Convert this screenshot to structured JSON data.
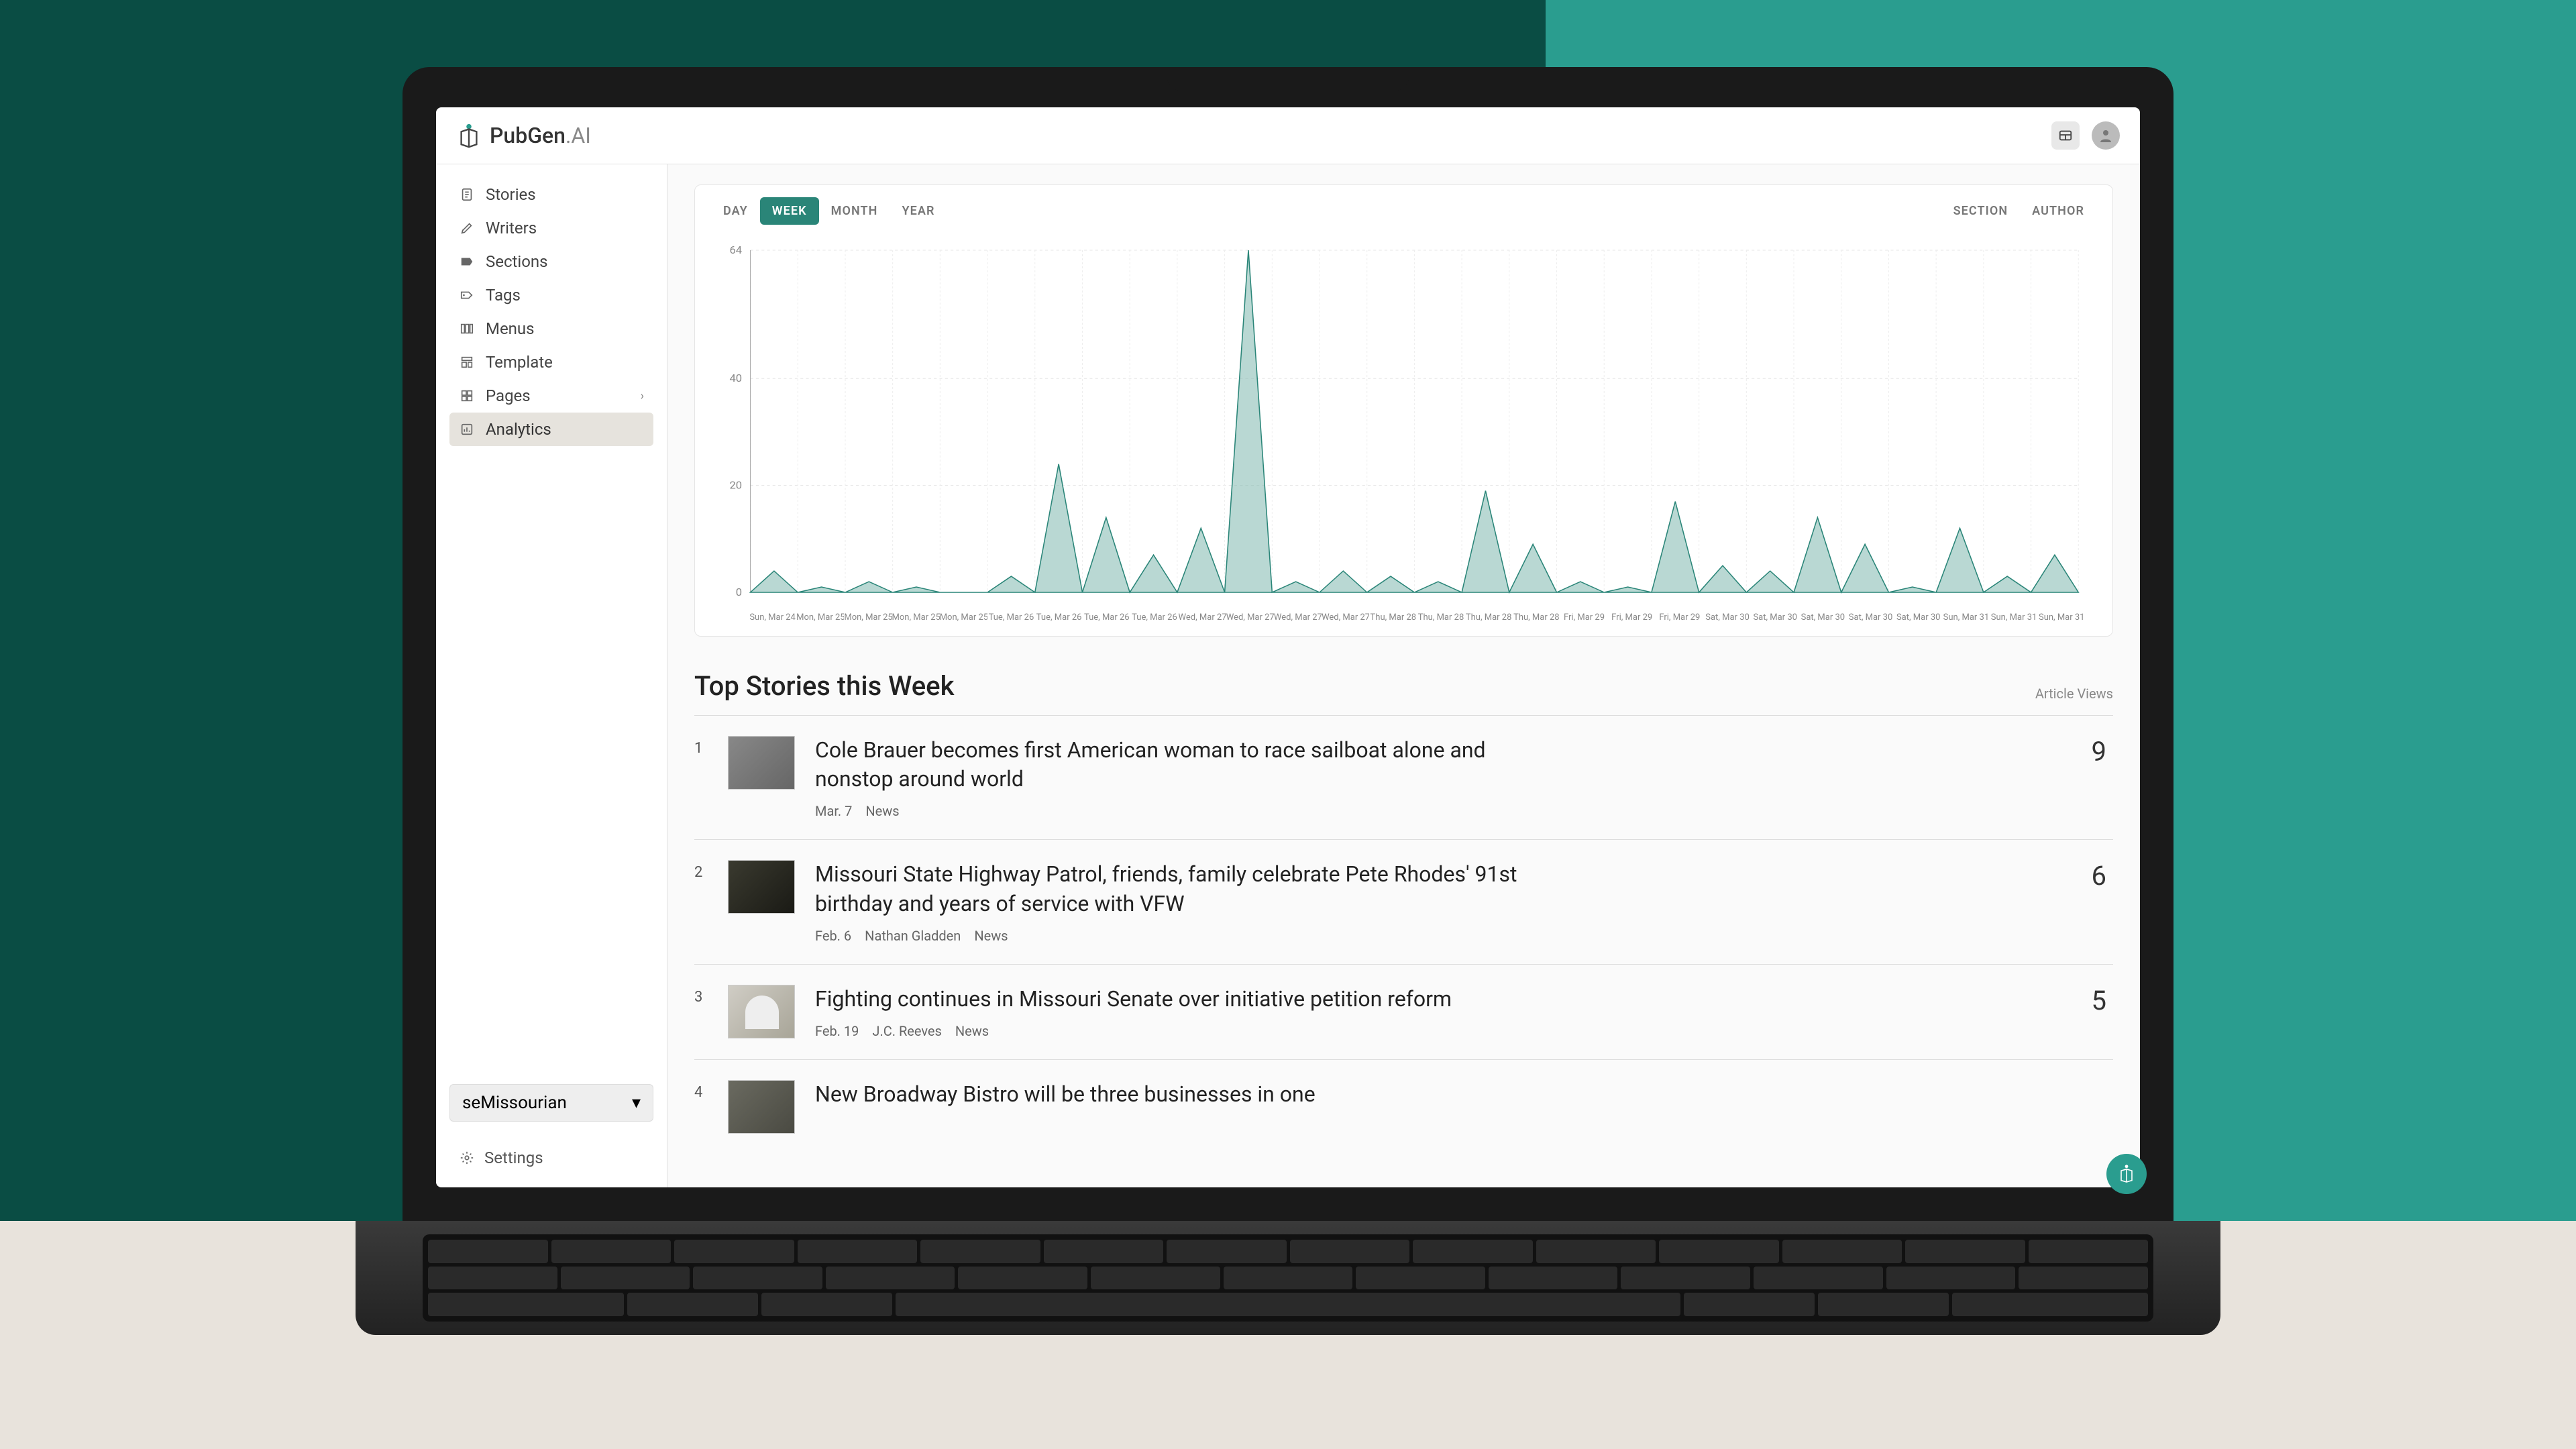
{
  "brand": {
    "name": "PubGen",
    "suffix": ".AI"
  },
  "sidebar": {
    "items": [
      {
        "label": "Stories"
      },
      {
        "label": "Writers"
      },
      {
        "label": "Sections"
      },
      {
        "label": "Tags"
      },
      {
        "label": "Menus"
      },
      {
        "label": "Template"
      },
      {
        "label": "Pages"
      },
      {
        "label": "Analytics"
      }
    ],
    "site": "seMissourian",
    "settings_label": "Settings"
  },
  "chart": {
    "periods": [
      "DAY",
      "WEEK",
      "MONTH",
      "YEAR"
    ],
    "active_period": "WEEK",
    "groups": [
      "SECTION",
      "AUTHOR"
    ]
  },
  "chart_data": {
    "type": "area",
    "title": "",
    "xlabel": "",
    "ylabel": "",
    "ylim": [
      0,
      64
    ],
    "yticks": [
      0,
      20,
      40,
      64
    ],
    "categories": [
      "Sun, Mar 24",
      "Mon, Mar 25",
      "Mon, Mar 25",
      "Mon, Mar 25",
      "Mon, Mar 25",
      "Tue, Mar 26",
      "Tue, Mar 26",
      "Tue, Mar 26",
      "Tue, Mar 26",
      "Wed, Mar 27",
      "Wed, Mar 27",
      "Wed, Mar 27",
      "Wed, Mar 27",
      "Thu, Mar 28",
      "Thu, Mar 28",
      "Thu, Mar 28",
      "Thu, Mar 28",
      "Fri, Mar 29",
      "Fri, Mar 29",
      "Fri, Mar 29",
      "Sat, Mar 30",
      "Sat, Mar 30",
      "Sat, Mar 30",
      "Sat, Mar 30",
      "Sat, Mar 30",
      "Sun, Mar 31",
      "Sun, Mar 31",
      "Sun, Mar 31"
    ],
    "values": [
      4,
      1,
      2,
      1,
      0,
      3,
      24,
      14,
      7,
      12,
      64,
      2,
      4,
      3,
      2,
      19,
      9,
      2,
      1,
      17,
      5,
      4,
      14,
      9,
      1,
      12,
      3,
      7
    ]
  },
  "top_stories": {
    "heading": "Top Stories this Week",
    "views_header": "Article Views",
    "items": [
      {
        "rank": "1",
        "title": "Cole Brauer becomes first American woman to race sailboat alone and nonstop around world",
        "date": "Mar. 7",
        "author": "",
        "section": "News",
        "views": "9"
      },
      {
        "rank": "2",
        "title": "Missouri State Highway Patrol, friends, family celebrate Pete Rhodes' 91st birthday and years of service with VFW",
        "date": "Feb. 6",
        "author": "Nathan Gladden",
        "section": "News",
        "views": "6"
      },
      {
        "rank": "3",
        "title": "Fighting continues in Missouri Senate over initiative petition reform",
        "date": "Feb. 19",
        "author": "J.C. Reeves",
        "section": "News",
        "views": "5"
      },
      {
        "rank": "4",
        "title": "New Broadway Bistro will be three businesses in one",
        "date": "",
        "author": "",
        "section": "",
        "views": ""
      }
    ]
  }
}
